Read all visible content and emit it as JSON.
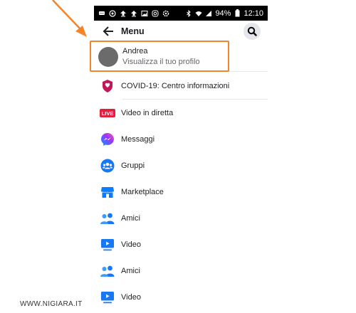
{
  "statusbar": {
    "battery": "94%",
    "time": "12:10",
    "icons": [
      "messages-icon",
      "skype-icon",
      "upload-icon",
      "upload-icon",
      "image-icon",
      "instagram-icon",
      "settings-icon",
      "bluetooth-icon",
      "wifi-icon",
      "signal-icon",
      "battery-icon"
    ]
  },
  "header": {
    "title": "Menu",
    "back_icon": "back-arrow-icon",
    "search_icon": "search-icon"
  },
  "profile": {
    "name": "Andrea",
    "subtitle": "Visualizza il tuo profilo"
  },
  "menu": {
    "items": [
      {
        "label": "COVID-19: Centro informazioni",
        "icon": "covid-shield-icon"
      },
      {
        "label": "Video in diretta",
        "icon": "live-icon",
        "badge": "LIVE"
      },
      {
        "label": "Messaggi",
        "icon": "messenger-icon"
      },
      {
        "label": "Gruppi",
        "icon": "groups-icon"
      },
      {
        "label": "Marketplace",
        "icon": "marketplace-icon"
      },
      {
        "label": "Amici",
        "icon": "friends-icon"
      },
      {
        "label": "Video",
        "icon": "video-icon"
      },
      {
        "label": "Amici",
        "icon": "friends-icon"
      },
      {
        "label": "Video",
        "icon": "video-icon"
      }
    ]
  },
  "watermark": "WWW.NIGIARA.IT",
  "colors": {
    "accent": "#1877f2",
    "highlight": "#f4842a",
    "live": "#e41e3f",
    "covid": "#c2185b"
  }
}
